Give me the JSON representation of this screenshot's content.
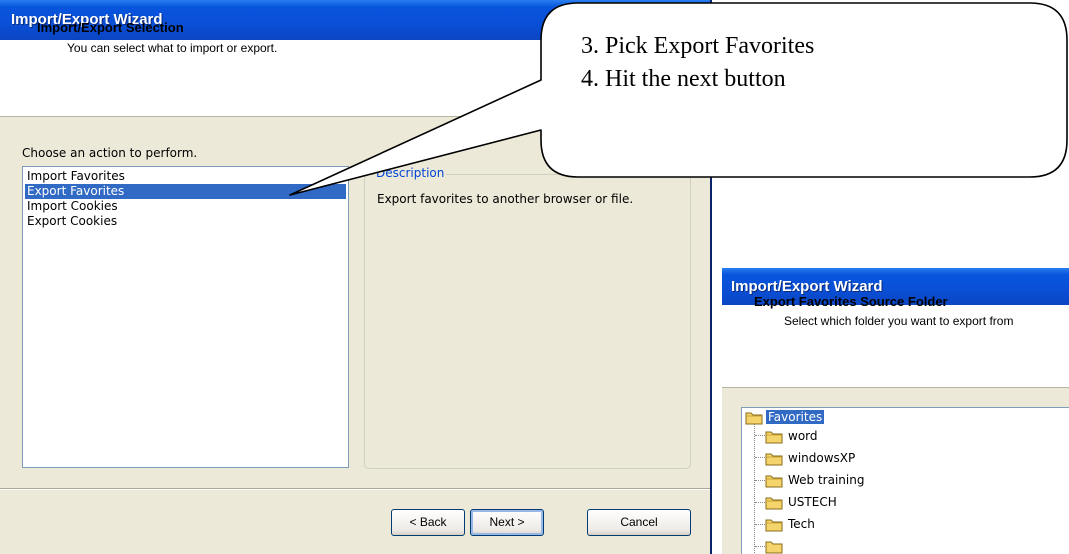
{
  "wizard_main": {
    "title": "Import/Export Wizard",
    "header_title": "Import/Export Selection",
    "header_subtitle": "You can select what to import or export.",
    "choose_label": "Choose an action to perform.",
    "actions": [
      "Import Favorites",
      "Export Favorites",
      "Import Cookies",
      "Export Cookies"
    ],
    "selected_action": "Export Favorites",
    "description_label": "Description",
    "description_text": "Export favorites to another browser or file.",
    "buttons": {
      "back": "< Back",
      "next": "Next >",
      "cancel": "Cancel"
    }
  },
  "callout": {
    "line1": "3. Pick Export Favorites",
    "line2": "4. Hit the next button"
  },
  "wizard_secondary": {
    "title": "Import/Export Wizard",
    "header_title": "Export Favorites Source Folder",
    "header_subtitle": "Select which folder you want to export from",
    "tree": {
      "root": "Favorites",
      "children": [
        "word",
        "windowsXP",
        "Web training",
        "USTECH",
        "Tech"
      ]
    }
  },
  "colors": {
    "title_bar": "#0a4fd6",
    "selection": "#316ac5",
    "dialog_bg": "#ece9d8",
    "group_label": "#0046d5",
    "folder": "#f5d46b"
  },
  "icons": {
    "folder": "folder-icon"
  }
}
